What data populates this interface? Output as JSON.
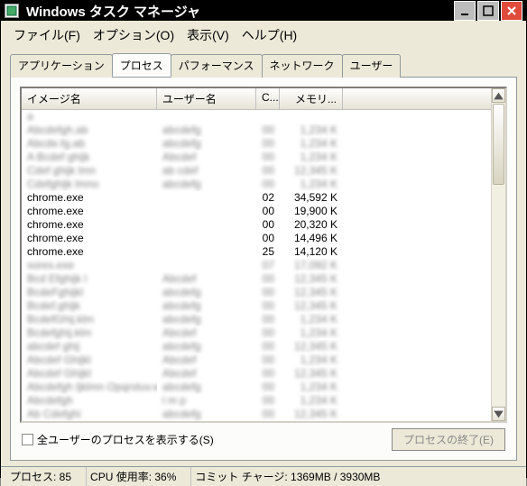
{
  "titlebar": {
    "title": "Windows タスク マネージャ"
  },
  "menu": {
    "file": "ファイル(F)",
    "options": "オプション(O)",
    "view": "表示(V)",
    "help": "ヘルプ(H)"
  },
  "tabs": {
    "applications": "アプリケーション",
    "processes": "プロセス",
    "performance": "パフォーマンス",
    "networking": "ネットワーク",
    "users": "ユーザー"
  },
  "columns": {
    "image_name": "イメージ名",
    "user_name": "ユーザー名",
    "cpu": "C...",
    "memory": "メモリ..."
  },
  "rows": [
    {
      "image": "a",
      "user": "",
      "cpu": "",
      "mem": "",
      "blur": true
    },
    {
      "image": "Abcdefgh.ab",
      "user": "abcdefg",
      "cpu": "00",
      "mem": "1,234 K",
      "blur": true
    },
    {
      "image": "Abcde.fg.ab",
      "user": "abcdefg",
      "cpu": "00",
      "mem": "1,234 K",
      "blur": true
    },
    {
      "image": "A Bcdef ghijk",
      "user": "Abcdef",
      "cpu": "00",
      "mem": "1,234 K",
      "blur": true
    },
    {
      "image": "Cdef ghijk lmn",
      "user": "ab cdef",
      "cpu": "00",
      "mem": "12,345 K",
      "blur": true
    },
    {
      "image": "Cdefghijk lmno",
      "user": "abcdefg",
      "cpu": "00",
      "mem": "1,234 K",
      "blur": true
    },
    {
      "image": "chrome.exe",
      "user": "",
      "cpu": "02",
      "mem": "34,592 K",
      "blur": false
    },
    {
      "image": "chrome.exe",
      "user": "",
      "cpu": "00",
      "mem": "19,900 K",
      "blur": false
    },
    {
      "image": "chrome.exe",
      "user": "",
      "cpu": "00",
      "mem": "20,320 K",
      "blur": false
    },
    {
      "image": "chrome.exe",
      "user": "",
      "cpu": "00",
      "mem": "14,496 K",
      "blur": false
    },
    {
      "image": "chrome.exe",
      "user": "",
      "cpu": "25",
      "mem": "14,120 K",
      "blur": false
    },
    {
      "image": "sores.exe",
      "user": "",
      "cpu": "07",
      "mem": "17,092 K",
      "blur": true
    },
    {
      "image": "Bcd Efghijk l",
      "user": "Abcdef",
      "cpu": "00",
      "mem": "12,345 K",
      "blur": true
    },
    {
      "image": "BcdeFghijkl",
      "user": "abcdefg",
      "cpu": "00",
      "mem": "12,345 K",
      "blur": true
    },
    {
      "image": "Bcdef.ghijk",
      "user": "abcdefg",
      "cpu": "00",
      "mem": "12,345 K",
      "blur": true
    },
    {
      "image": "BcdefGhij.klm",
      "user": "abcdefg",
      "cpu": "00",
      "mem": "1,234 K",
      "blur": true
    },
    {
      "image": "Bcdefghij.klm",
      "user": "Abcdef",
      "cpu": "00",
      "mem": "1,234 K",
      "blur": true
    },
    {
      "image": "abcdef ghij",
      "user": "abcdefg",
      "cpu": "00",
      "mem": "12,345 K",
      "blur": true
    },
    {
      "image": "Abcdef Ghijkl",
      "user": "Abcdef",
      "cpu": "00",
      "mem": "1,234 K",
      "blur": true
    },
    {
      "image": "Abcdef Ghijkl",
      "user": "Abcdef",
      "cpu": "00",
      "mem": "12,345 K",
      "blur": true
    },
    {
      "image": "Abcdefgh Ijklmn Opqrstuv.w x",
      "user": "abcdefg",
      "cpu": "00",
      "mem": "1,234 K",
      "blur": true
    },
    {
      "image": "Abcdefgh",
      "user": "l m p",
      "cpu": "00",
      "mem": "1,234 K",
      "blur": true
    },
    {
      "image": "Ab Cdefghi",
      "user": "abcdefg",
      "cpu": "00",
      "mem": "12,345 K",
      "blur": true
    }
  ],
  "bottom": {
    "show_all_users": "全ユーザーのプロセスを表示する(S)",
    "end_process": "プロセスの終了(E)"
  },
  "status": {
    "processes": "プロセス: 85",
    "cpu_usage": "CPU 使用率: 36%",
    "commit_charge": "コミット チャージ: 1369MB / 3930MB"
  }
}
